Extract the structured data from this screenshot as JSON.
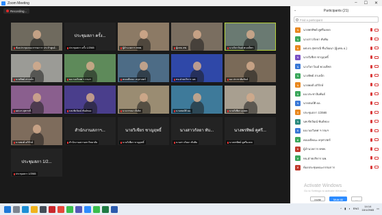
{
  "window": {
    "title": "Zoom Meeting"
  },
  "recording": {
    "label": "Recording..."
  },
  "tiles": [
    {
      "name": "ห้องประชุมคณะกรรมการ ประจำศูนย์...",
      "type": "video",
      "bg": "#6f6a5e"
    },
    {
      "name": "ประชุมสภา ครั้ง 1/2565",
      "type": "name",
      "big": "ประชุมสภา ครั้ง..."
    },
    {
      "name": "ผู้อำนวยการ ทชพ.",
      "type": "video",
      "bg": "#8c7a65"
    },
    {
      "name": "ผู้แทน สพ.",
      "type": "video",
      "bg": "#7a6e60"
    },
    {
      "name": "นางวิลาวัณย์ พวงเพ็ชร",
      "type": "video",
      "bg": "#6a7a72",
      "speaking": true
    },
    {
      "name": "นางทิพย์ สาเหล็ก",
      "type": "video",
      "bg": "#9b9b96"
    },
    {
      "name": "ผอ.กองวิเทศ ฯ กรมฯ",
      "type": "video",
      "bg": "#5e8a5a"
    },
    {
      "name": "คณบดีคณะ ครุศาสตร์",
      "type": "video",
      "bg": "#4d6c86"
    },
    {
      "name": "หน.ฝ่ายบริหาร นพ.",
      "type": "video",
      "bg": "#2f48a8"
    },
    {
      "name": "ผอ.ประชาสัมพันธ์",
      "type": "video",
      "bg": "#7a6a58"
    },
    {
      "name": "ผศ.ดร.สุพรรณี",
      "type": "video",
      "bg": "#8a5f8e"
    },
    {
      "name": "นพ.ชัยวัฒน์ พันธ์ทอง",
      "type": "video",
      "bg": "#4a3e8c"
    },
    {
      "name": "นางวรรณา ดีเลิศ",
      "type": "video",
      "bg": "#9a8c72"
    },
    {
      "name": "นายสมบัติ ผอ.",
      "type": "video",
      "bg": "#3e7a9a"
    },
    {
      "name": "นายวิเชียร อุปคต",
      "type": "video",
      "bg": "#a89f90"
    },
    {
      "name": "นายพงศ์ อภิรักษ์",
      "type": "video",
      "bg": "#7e6c5c"
    },
    {
      "name": "สำนักงานสภามหาวิทยาลัย",
      "type": "name",
      "big": "สำนักงานสภาฯ..."
    },
    {
      "name": "นายวิเชียร ชาญฤทธิ์",
      "type": "name",
      "big": "นายวิเชียร ชาญฤทธิ์"
    },
    {
      "name": "นางสาวกัลยา ทับทิม",
      "type": "name",
      "big": "นางสาวกัลยา ทับ..."
    },
    {
      "name": "นางพรทิพย์ คูศรีมงคล",
      "type": "name",
      "big": "นางพรทิพย์ คูศรี..."
    },
    {
      "name": "ประชุมสภา 1/2565",
      "type": "name",
      "big": "ประชุมสภา 1/2..."
    }
  ],
  "panel": {
    "title": "Participants (21)",
    "search_placeholder": "Find a participant",
    "participants": [
      {
        "name": "นายพรทิพย์ คูศรีมงคล",
        "color": "#e8871e",
        "initial": "น"
      },
      {
        "name": "นางสาวกัลยา ทับทิม",
        "color": "#3aa65a",
        "initial": "น"
      },
      {
        "name": "ผศ.ดร.สุพรรณี ชื่นวัฒนา (ผู้แทน อ.)",
        "color": "#e8871e",
        "initial": "ผ"
      },
      {
        "name": "นายวิเชียร ชาญฤทธิ์",
        "color": "#7a4fc4",
        "initial": "น"
      },
      {
        "name": "นางวิลาวัณย์ พวงเพ็ชร",
        "color": "#3a78d6",
        "initial": "น"
      },
      {
        "name": "นางทิพย์ สาเหล็ก",
        "color": "#3aa65a",
        "initial": "น"
      },
      {
        "name": "นายพงศ์ อภิรักษ์",
        "color": "#e8871e",
        "initial": "น"
      },
      {
        "name": "ผอ.ประชาสัมพันธ์",
        "color": "#3aa65a",
        "initial": "ผ"
      },
      {
        "name": "นายสมบัติ ผอ.",
        "color": "#3a78d6",
        "initial": "น"
      },
      {
        "name": "ประชุมสภา 1/2565",
        "color": "#e8871e",
        "initial": "ป"
      },
      {
        "name": "นพ.ชัยวัฒน์ พันธ์ทอง",
        "color": "#2b8a7e",
        "initial": "น"
      },
      {
        "name": "ผอ.กองวิเทศ ฯ กรมฯ",
        "color": "#3a78d6",
        "initial": "ผ"
      },
      {
        "name": "คณบดีคณะ ครุศาสตร์",
        "color": "#3aa65a",
        "initial": "ค"
      },
      {
        "name": "ผู้อำนวยการ ทชพ.",
        "color": "#c0392b",
        "initial": "ผ"
      },
      {
        "name": "หน.ฝ่ายบริหาร นพ.",
        "color": "#3aa65a",
        "initial": "ห"
      },
      {
        "name": "ห้องประชุมคณะกรรมการ",
        "color": "#c0392b",
        "initial": "ห"
      }
    ],
    "invite_label": "Invite",
    "mute_all_label": "Mute All",
    "more_label": "..."
  },
  "watermark": {
    "line1": "Activate Windows",
    "line2": "Go to Settings to activate Windows."
  },
  "taskbar": {
    "time": "14:14",
    "date": "16/1/2565",
    "lang": "ENG",
    "apps": [
      {
        "name": "start",
        "color": "#1e78d7"
      },
      {
        "name": "search",
        "color": "#7b8490"
      },
      {
        "name": "edge",
        "color": "#1c8fd6"
      },
      {
        "name": "file-explorer",
        "color": "#f1b31c"
      },
      {
        "name": "store",
        "color": "#444c56"
      },
      {
        "name": "acrobat",
        "color": "#c9272c"
      },
      {
        "name": "chrome",
        "color": "#e7483b"
      },
      {
        "name": "line",
        "color": "#3abe4d"
      },
      {
        "name": "teams",
        "color": "#5458b8"
      },
      {
        "name": "zoom",
        "color": "#2d8cff"
      },
      {
        "name": "line-2",
        "color": "#3abe4d"
      },
      {
        "name": "excel",
        "color": "#1f7a43"
      },
      {
        "name": "word",
        "color": "#2b5aad"
      }
    ]
  }
}
